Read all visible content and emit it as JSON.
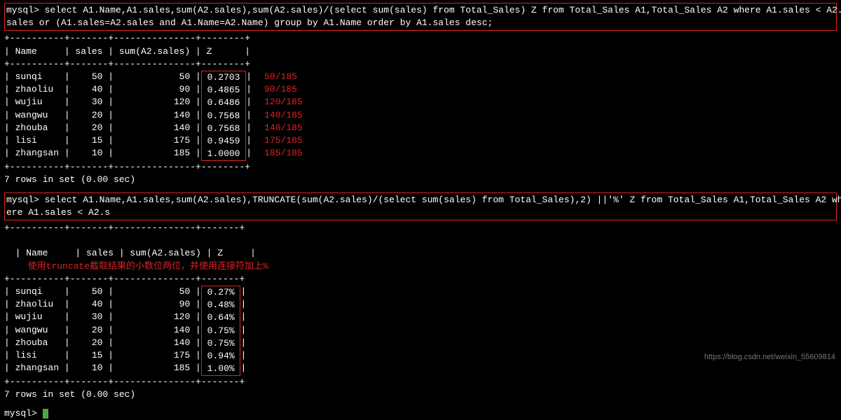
{
  "query1": {
    "prompt": "mysql>",
    "sql_line1": " select A1.Name,A1.sales,sum(A2.sales),sum(A2.sales)/(select sum(sales) from Total_Sales) Z from Total_Sales A1,Total_Sales A2 where A1.sales < A2.",
    "sql_line2": "sales or (A1.sales=A2.sales and A1.Name=A2.Name) group by A1.Name order by A1.sales desc;"
  },
  "table1": {
    "sep": "+----------+-------+---------------+--------+",
    "header": "| Name     | sales | sum(A2.sales) | Z      |",
    "rows_left": [
      "| sunqi    |    50 |            50 |",
      "| zhaoliu  |    40 |            90 |",
      "| wujiu    |    30 |           120 |",
      "| wangwu   |    20 |           140 |",
      "| zhouba   |    20 |           140 |",
      "| lisi     |    15 |           175 |",
      "| zhangsan |    10 |           185 |"
    ],
    "z_values": [
      " 0.2703 ",
      " 0.4865 ",
      " 0.6486 ",
      " 0.7568 ",
      " 0.7568 ",
      " 0.9459 ",
      " 1.0000 "
    ],
    "row_tail": "|",
    "annotations": [
      "50/185",
      "90/185",
      "120/185",
      "140/185",
      "140/185",
      "175/185",
      "185/185"
    ],
    "status": "7 rows in set (0.00 sec)"
  },
  "query2": {
    "prompt": "mysql>",
    "sql_line1": " select A1.Name,A1.sales,sum(A2.sales),TRUNCATE(sum(A2.sales)/(select sum(sales) from Total_Sales),2) ||'%' Z from Total_Sales A1,Total_Sales A2 wh",
    "sql_line2": "ere A1.sales < A2.s"
  },
  "table2": {
    "sep": "+----------+-------+---------------+-------+",
    "header": "| Name     | sales | sum(A2.sales) | Z     |",
    "annotation_inline": "使用truncate截取结果的小数位两位，并使用连接符加上%",
    "rows_left": [
      "| sunqi    |    50 |            50 |",
      "| zhaoliu  |    40 |            90 |",
      "| wujiu    |    30 |           120 |",
      "| wangwu   |    20 |           140 |",
      "| zhouba   |    20 |           140 |",
      "| lisi     |    15 |           175 |",
      "| zhangsan |    10 |           185 |"
    ],
    "z_values": [
      " 0.27% ",
      " 0.48% ",
      " 0.64% ",
      " 0.75% ",
      " 0.75% ",
      " 0.94% ",
      " 1.00% "
    ],
    "row_tail": "|",
    "status": "7 rows in set (0.00 sec)"
  },
  "final_prompt": "mysql> ",
  "watermark": "https://blog.csdn.net/weixin_55609814",
  "chart_data": {
    "type": "table",
    "tables": [
      {
        "columns": [
          "Name",
          "sales",
          "sum(A2.sales)",
          "Z"
        ],
        "rows": [
          [
            "sunqi",
            50,
            50,
            0.2703
          ],
          [
            "zhaoliu",
            40,
            90,
            0.4865
          ],
          [
            "wujiu",
            30,
            120,
            0.6486
          ],
          [
            "wangwu",
            20,
            140,
            0.7568
          ],
          [
            "zhouba",
            20,
            140,
            0.7568
          ],
          [
            "lisi",
            15,
            175,
            0.9459
          ],
          [
            "zhangsan",
            10,
            185,
            1.0
          ]
        ],
        "annotations": [
          "50/185",
          "90/185",
          "120/185",
          "140/185",
          "140/185",
          "175/185",
          "185/185"
        ]
      },
      {
        "columns": [
          "Name",
          "sales",
          "sum(A2.sales)",
          "Z"
        ],
        "rows": [
          [
            "sunqi",
            50,
            50,
            "0.27%"
          ],
          [
            "zhaoliu",
            40,
            90,
            "0.48%"
          ],
          [
            "wujiu",
            30,
            120,
            "0.64%"
          ],
          [
            "wangwu",
            20,
            140,
            "0.75%"
          ],
          [
            "zhouba",
            20,
            140,
            "0.75%"
          ],
          [
            "lisi",
            15,
            175,
            "0.94%"
          ],
          [
            "zhangsan",
            10,
            185,
            "1.00%"
          ]
        ]
      }
    ]
  }
}
